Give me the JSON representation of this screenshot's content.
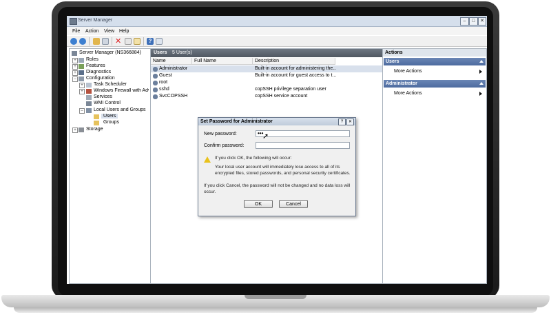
{
  "window": {
    "title": "Server Manager"
  },
  "menu": [
    "File",
    "Action",
    "View",
    "Help"
  ],
  "tree": {
    "root": "Server Manager (NS366884)",
    "roles": "Roles",
    "features": "Features",
    "diagnostics": "Diagnostics",
    "configuration": "Configuration",
    "task_scheduler": "Task Scheduler",
    "firewall": "Windows Firewall with Adva",
    "services": "Services",
    "wmi": "WMI Control",
    "local_users_groups": "Local Users and Groups",
    "users": "Users",
    "groups": "Groups",
    "storage": "Storage"
  },
  "center": {
    "header_title": "Users",
    "header_count": "5 User(s)",
    "columns": [
      "Name",
      "Full Name",
      "Description"
    ],
    "rows": [
      {
        "name": "Administrator",
        "full_name": "",
        "description": "Built-in account for administering the..."
      },
      {
        "name": "Guest",
        "full_name": "",
        "description": "Built-in account for guest access to t..."
      },
      {
        "name": "root",
        "full_name": "",
        "description": ""
      },
      {
        "name": "sshd",
        "full_name": "",
        "description": "copSSH privilege separation user"
      },
      {
        "name": "SvcCOPSSH",
        "full_name": "",
        "description": "copSSH service account"
      }
    ]
  },
  "actions": {
    "title": "Actions",
    "sections": [
      {
        "label": "Users",
        "item": "More Actions"
      },
      {
        "label": "Administrator",
        "item": "More Actions"
      }
    ]
  },
  "dialog": {
    "title": "Set Password for Administrator",
    "help_btn": "?",
    "close_btn": "✕",
    "new_password_label": "New password:",
    "new_password_value": "•••",
    "confirm_password_label": "Confirm password:",
    "confirm_password_value": "",
    "warning_line1": "If you click OK, the following will occur:",
    "warning_body": "Your local user account will immediately lose access to all of its encrypted files, stored passwords, and personal security certificates.",
    "cancel_note": "If you click Cancel, the password will not be changed and no data loss will occur.",
    "ok_label": "OK",
    "cancel_label": "Cancel"
  },
  "colors": {
    "accent": "#4d6b9f",
    "header_dark": "#4f5761",
    "selection": "#d8e0ec"
  }
}
